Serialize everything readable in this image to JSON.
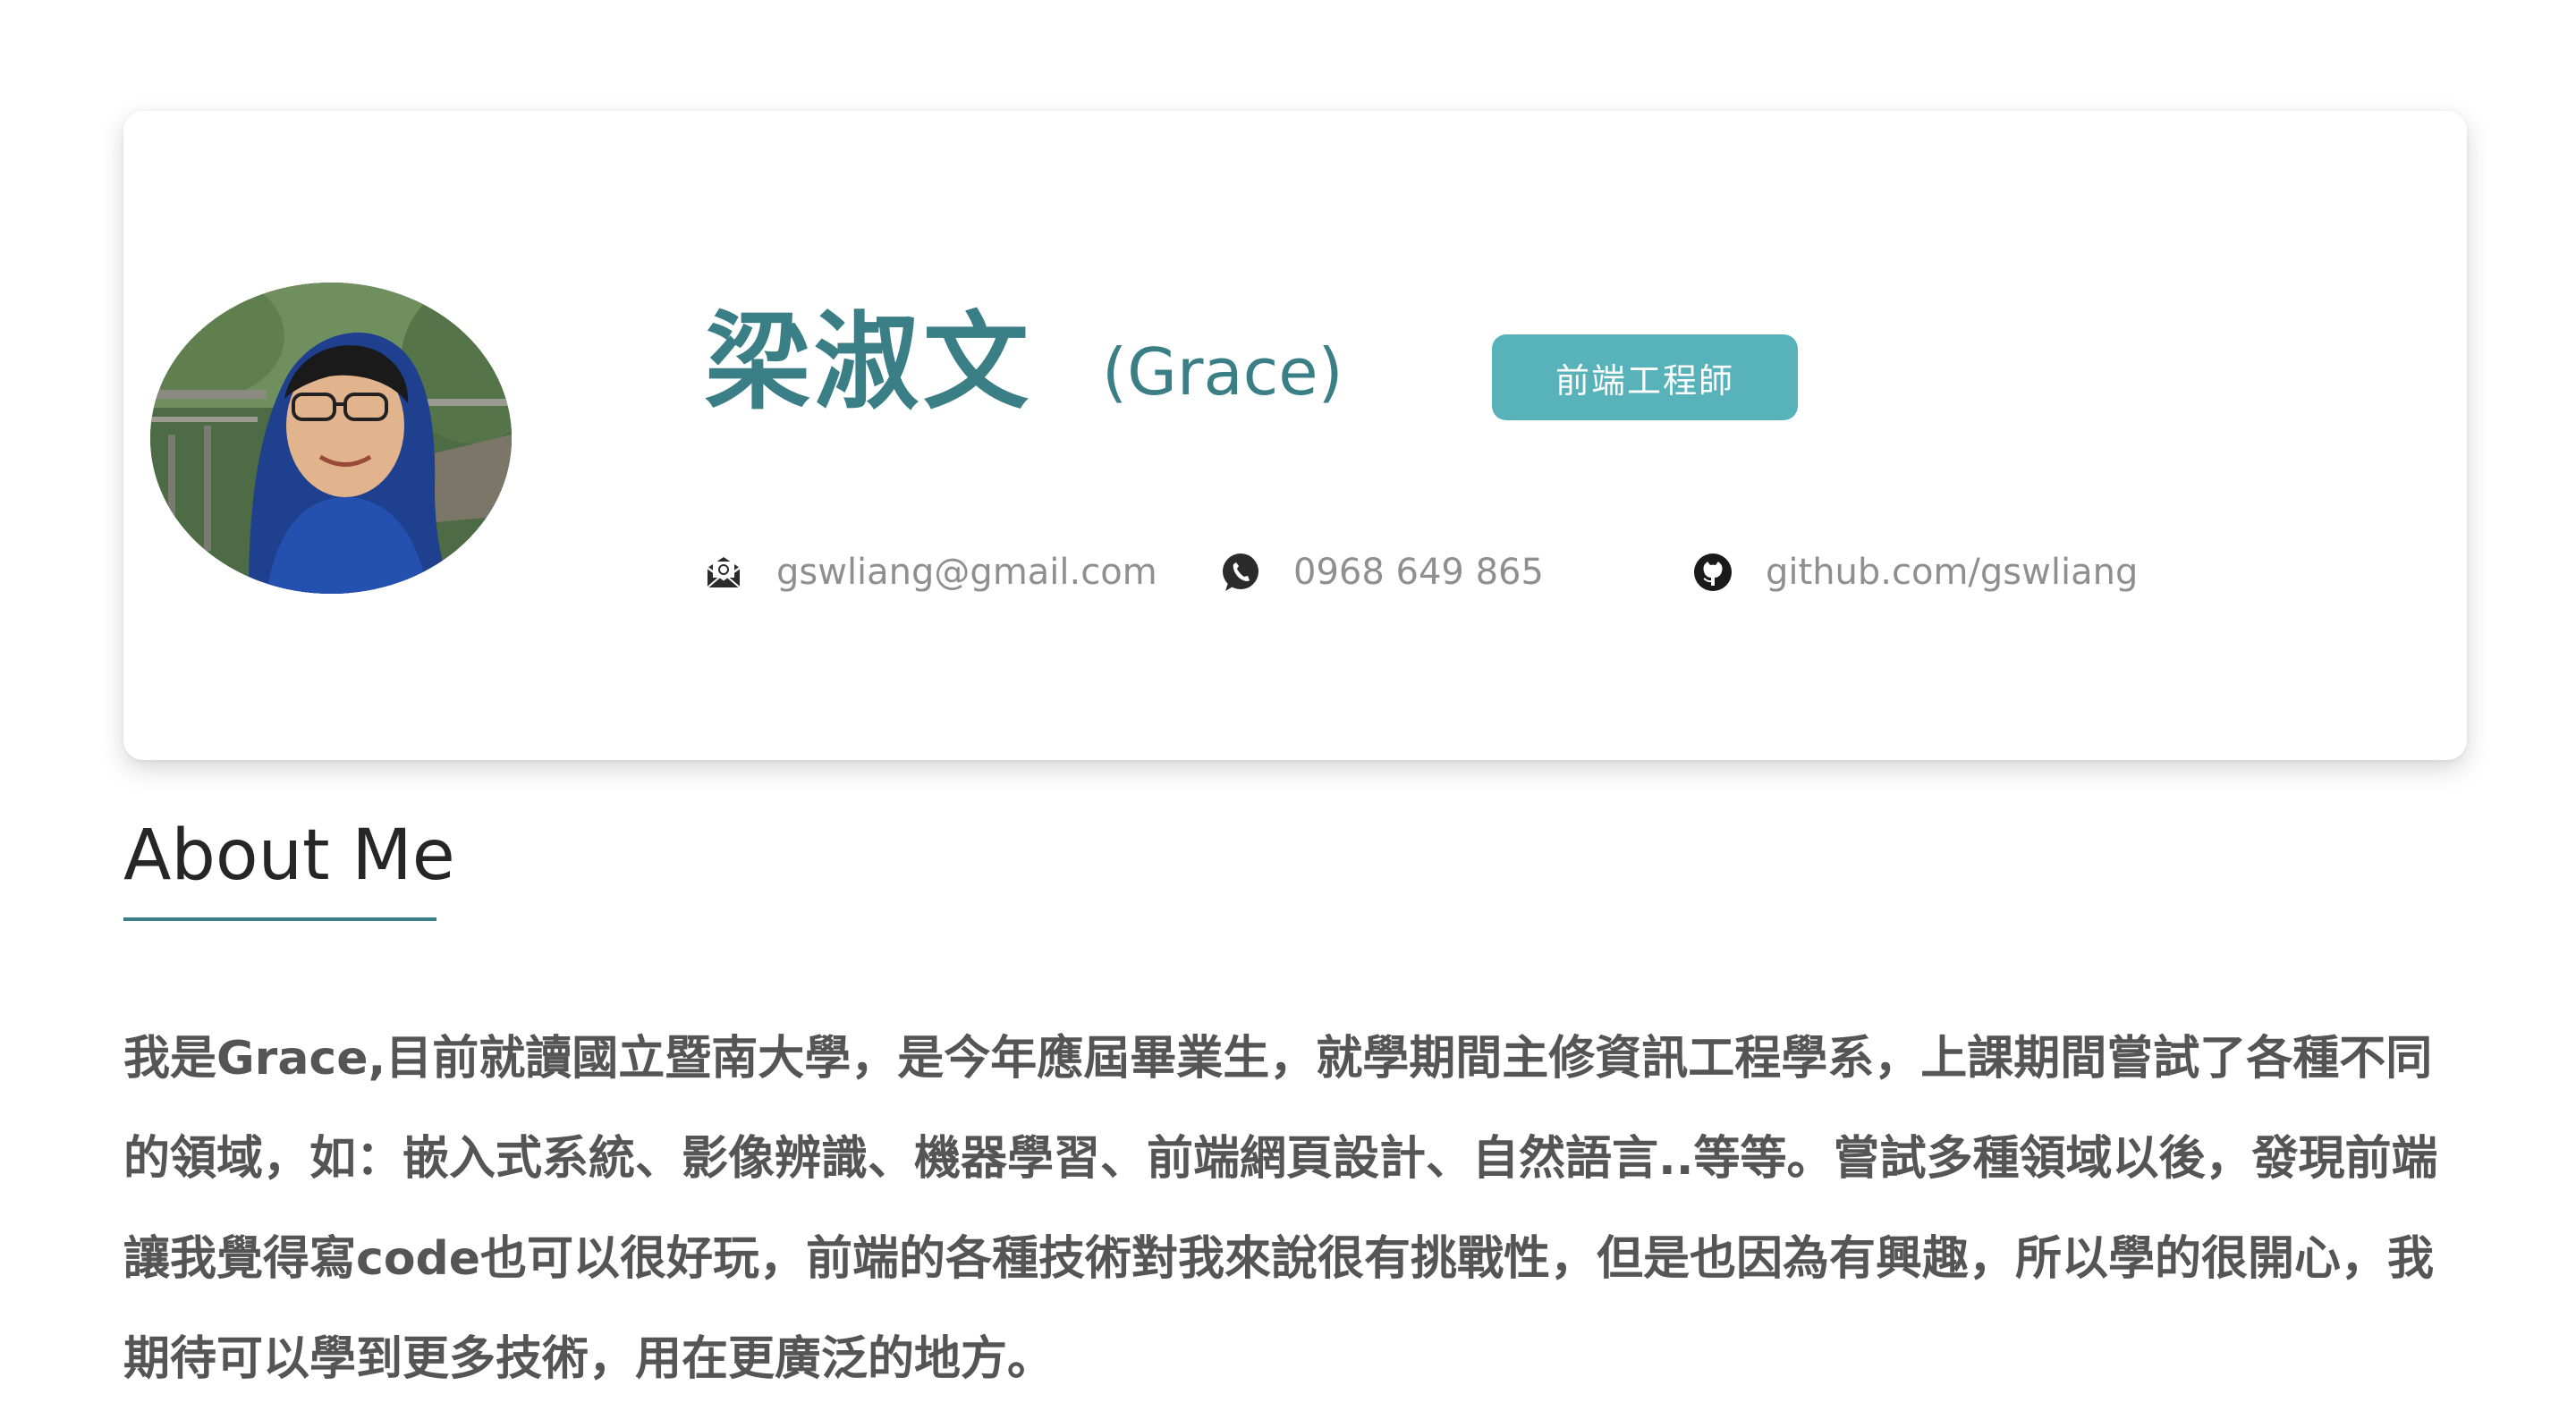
{
  "profile": {
    "name": "梁淑文",
    "nickname": "(Grace)",
    "role_badge": "前端工程師",
    "contacts": {
      "email": {
        "icon": "envelope-icon",
        "text": "gswliang@gmail.com"
      },
      "phone": {
        "icon": "whatsapp-icon",
        "text": "0968 649 865"
      },
      "github": {
        "icon": "github-icon",
        "text": "github.com/gswliang"
      }
    }
  },
  "about": {
    "title": "About Me",
    "paragraph": "我是Grace,目前就讀國立暨南大學，是今年應屆畢業生，就學期間主修資訊工程學系，上課期間嘗試了各種不同的領域，如：嵌入式系統、影像辨識、機器學習、前端網頁設計、自然語言..等等。嘗試多種領域以後，發現前端讓我覺得寫code也可以很好玩，前端的各種技術對我來說很有挑戰性，但是也因為有興趣，所以學的很開心，我期待可以學到更多技術，用在更廣泛的地方。"
  },
  "colors": {
    "accent": "#3b7f86",
    "badge": "#58b2b9",
    "muted_text": "#8f8f8f",
    "body_text": "#555555"
  }
}
